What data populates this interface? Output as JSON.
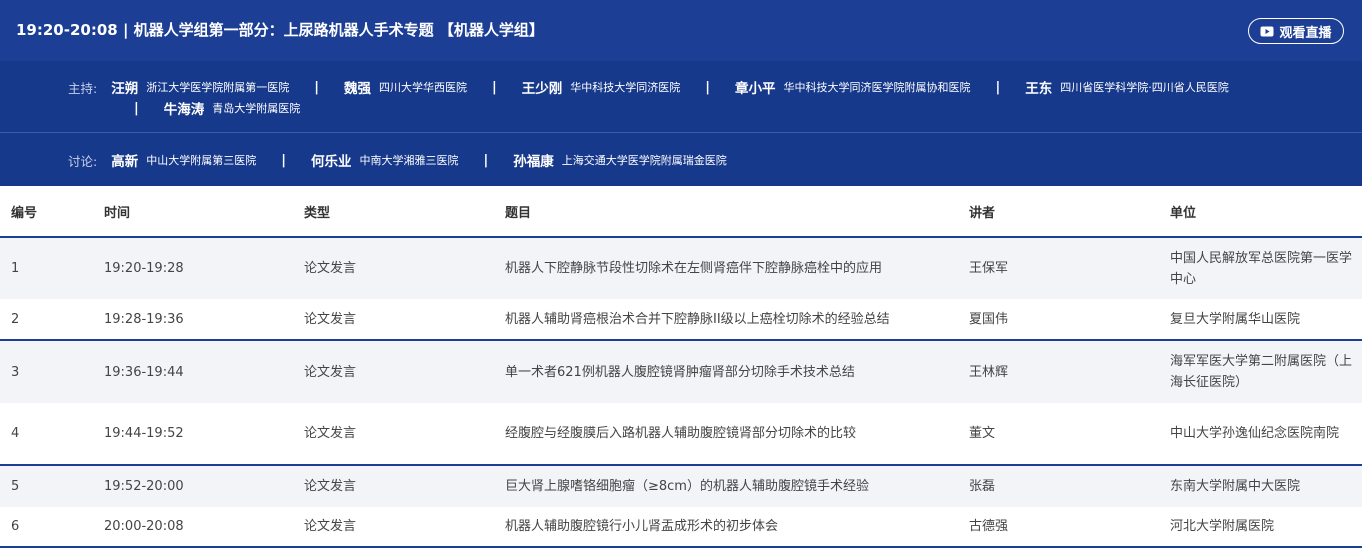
{
  "session": {
    "title": "19:20-20:08 | 机器人学组第一部分：上尿路机器人手术专题 【机器人学组】",
    "live_button_label": "观看直播",
    "icons": {
      "live": "play-icon"
    },
    "colors": {
      "header_bg": "#1c3f95",
      "host_bg": "#17398b",
      "accent": "#1c3f95",
      "row_alt": "#f3f4f8"
    }
  },
  "hosts": {
    "label": "主持:",
    "people": [
      {
        "name": "汪朔",
        "affiliation": "浙江大学医学院附属第一医院"
      },
      {
        "name": "魏强",
        "affiliation": "四川大学华西医院"
      },
      {
        "name": "王少刚",
        "affiliation": "华中科技大学同济医院"
      },
      {
        "name": "章小平",
        "affiliation": "华中科技大学同济医学院附属协和医院"
      },
      {
        "name": "王东",
        "affiliation": "四川省医学科学院·四川省人民医院"
      },
      {
        "name": "牛海涛",
        "affiliation": "青岛大学附属医院"
      }
    ],
    "separator": "|"
  },
  "discussants": {
    "label": "讨论:",
    "people": [
      {
        "name": "高新",
        "affiliation": "中山大学附属第三医院"
      },
      {
        "name": "何乐业",
        "affiliation": "中南大学湘雅三医院"
      },
      {
        "name": "孙福康",
        "affiliation": "上海交通大学医学院附属瑞金医院"
      }
    ],
    "separator": "|"
  },
  "table": {
    "columns": [
      "编号",
      "时间",
      "类型",
      "题目",
      "讲者",
      "单位"
    ],
    "rows": [
      {
        "no": "1",
        "time": "19:20-19:28",
        "type": "论文发言",
        "topic": "机器人下腔静脉节段性切除术在左侧肾癌伴下腔静脉癌栓中的应用",
        "speaker": "王保军",
        "unit": "中国人民解放军总医院第一医学中心"
      },
      {
        "no": "2",
        "time": "19:28-19:36",
        "type": "论文发言",
        "topic": "机器人辅助肾癌根治术合并下腔静脉II级以上癌栓切除术的经验总结",
        "speaker": "夏国伟",
        "unit": "复旦大学附属华山医院"
      },
      {
        "no": "3",
        "time": "19:36-19:44",
        "type": "论文发言",
        "topic": "单一术者621例机器人腹腔镜肾肿瘤肾部分切除手术技术总结",
        "speaker": "王林辉",
        "unit": "海军军医大学第二附属医院（上海长征医院）"
      },
      {
        "no": "4",
        "time": "19:44-19:52",
        "type": "论文发言",
        "topic": "经腹腔与经腹膜后入路机器人辅助腹腔镜肾部分切除术的比较",
        "speaker": "董文",
        "unit": "中山大学孙逸仙纪念医院南院"
      },
      {
        "no": "5",
        "time": "19:52-20:00",
        "type": "论文发言",
        "topic": "巨大肾上腺嗜铬细胞瘤（≥8cm）的机器人辅助腹腔镜手术经验",
        "speaker": "张磊",
        "unit": "东南大学附属中大医院"
      },
      {
        "no": "6",
        "time": "20:00-20:08",
        "type": "论文发言",
        "topic": "机器人辅助腹腔镜行小儿肾盂成形术的初步体会",
        "speaker": "古德强",
        "unit": "河北大学附属医院"
      }
    ]
  }
}
